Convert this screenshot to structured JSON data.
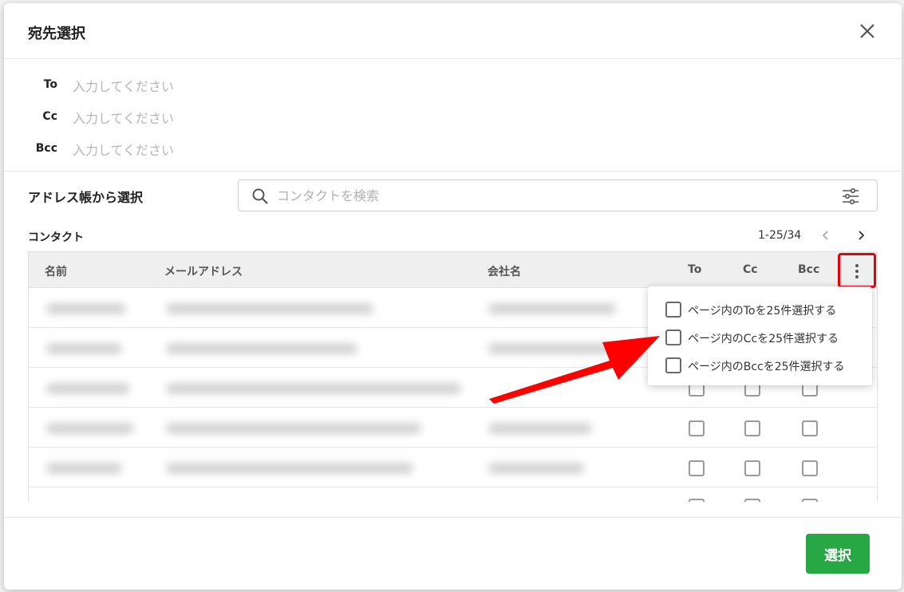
{
  "dialog": {
    "title": "宛先選択"
  },
  "recipients": [
    {
      "label": "To",
      "placeholder": "入力してください",
      "value": ""
    },
    {
      "label": "Cc",
      "placeholder": "入力してください",
      "value": ""
    },
    {
      "label": "Bcc",
      "placeholder": "入力してください",
      "value": ""
    }
  ],
  "address_book": {
    "title": "アドレス帳から選択",
    "search_placeholder": "コンタクトを検索"
  },
  "contacts": {
    "label": "コンタクト",
    "pagination": "1-25/34",
    "columns": {
      "name": "名前",
      "email": "メールアドレス",
      "company": "会社名",
      "to": "To",
      "cc": "Cc",
      "bcc": "Bcc"
    }
  },
  "bulk_menu": {
    "items": [
      "ページ内のToを25件選択する",
      "ページ内のCcを25件選択する",
      "ページ内のBccを25件選択する"
    ]
  },
  "footer": {
    "select_label": "選択"
  },
  "colors": {
    "primary_button": "#27a844",
    "highlight": "#e8000b",
    "annotation_arrow": "#ff0000"
  }
}
